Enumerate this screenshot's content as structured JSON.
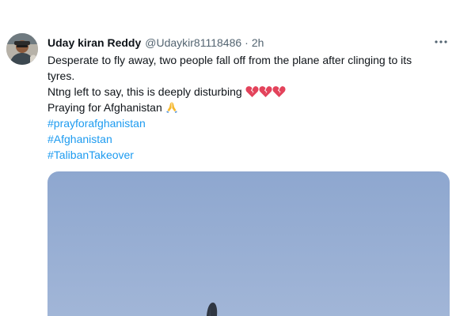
{
  "tweet": {
    "author": {
      "display_name": "Uday kiran Reddy",
      "handle": "@Udaykir81118486"
    },
    "separator": "·",
    "time": "2h",
    "text": {
      "line1": "Desperate to fly away, two people fall off from the plane after clinging to its",
      "line2": "tyres.",
      "line3": "Ntng left to say, this is deeply disturbing",
      "line4": "Praying for Afghanistan"
    },
    "hashtags": [
      "#prayforafghanistan",
      "#Afghanistan",
      "#TalibanTakeover"
    ],
    "emojis": {
      "after_line3": [
        "broken-heart-icon",
        "broken-heart-icon",
        "broken-heart-icon"
      ],
      "after_line4": [
        "folded-hands-icon"
      ]
    },
    "icons": {
      "more": "more-options-icon"
    }
  },
  "colors": {
    "text_primary": "#0f1419",
    "text_secondary": "#536471",
    "link": "#1d9bf0",
    "broken_heart": "#e3435b",
    "sky_top": "#8da6cf",
    "sky_bottom": "#9fb4d6"
  }
}
